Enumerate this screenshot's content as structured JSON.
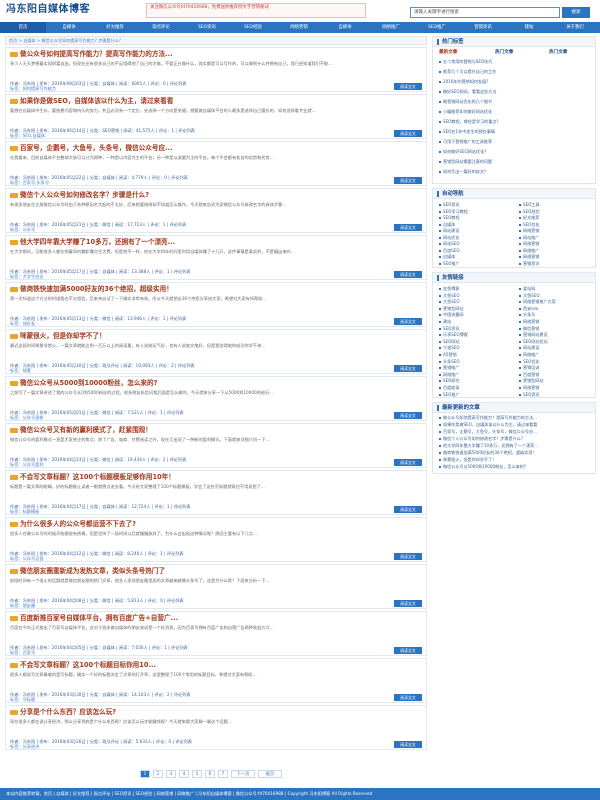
{
  "site": {
    "title": "冯东阳自媒体博客",
    "banner": [
      "关注微信公众号fd70416988，免费送你推荐例文字营销秘诀",
      "",
      ""
    ],
    "search_placeholder": "请输入关键字进行搜索",
    "search_button": "搜索"
  },
  "nav": [
    "首页",
    "自媒体",
    "好文推荐",
    "观点评论",
    "SEO资讯",
    "SEO经验",
    "网络营销",
    "自媒体",
    "网络推广",
    "SEO推广",
    "营销资讯",
    "建站",
    "关于我们"
  ],
  "breadcrumb": "首页 > 自媒体 > 微信公众号如何提高写作能力? 步骤是什么?",
  "articles": [
    {
      "title": "做公众号如何提高写作能力？提高写作能力的方法...",
      "excerpt": "多少人天天梦想着实现财富自由，但现在还有很多自己的不足阻碍他了自己的才能。不管正在做什么，其实都是可以写作的，可以做到什么并拥有自己，我已经知道我们不能…",
      "meta": "作者：冯东阳 | 发布：2016年09月03日 | 分类：自媒体 | 阅读：6005人 | 评论：0 | 评论列表",
      "tags": "标签：如何提高写作能力",
      "more": "阅读全文"
    },
    {
      "title": "如果你是做SEO，自媒体该以什么为主，请过来看看",
      "excerpt": "要想在自媒体中生存，要依靠内容和持久的努力，并且必须有一个定位，先选择一个方向是关键。想要做自媒体平台的人最多是选择自己擅长的，如何选择看专业就…",
      "meta": "作者：冯东阳 | 发布：2016年06月14日 | 分类：SEO营销 | 阅读：41,575人 | 评论：1 | 评论列表",
      "tags": "标签：SEO,自媒体",
      "more": "阅读全文"
    },
    {
      "title": "百家号，企鹅号，大鱼号，头条号，微信公众号应...",
      "excerpt": "在我看来，目前自媒体平台整体大致可以分为两种，一种是以内容为主的平台，另一种是以流量为主的平台。每个平台都有各自的优势和劣势…",
      "meta": "作者：冯东阳 | 发布：2016年05月22日 | 分类：自媒体 | 阅读：4,779人 | 评论：0 | 评论列表",
      "tags": "标签：百家号,头条号",
      "more": "阅读全文"
    },
    {
      "title": "微信个人公众号如何修改名字？步骤是什么?",
      "excerpt": "有很多朋友在注册微信公众号时由于各种原因名字起的不太好，后来想要修改却不知道怎么操作。今天就来告诉大家微信公众号修改名字的具体步骤…",
      "meta": "作者：冯东阳 | 发布：2016年05月21日 | 分类：微信 | 阅读：17,713人 | 评论：1 | 评论列表",
      "tags": "标签：公众号",
      "more": "阅读全文"
    },
    {
      "title": "他大学四年靠大学赚了10多万，还拥有了一个漂亮...",
      "excerpt": "在大学期间，可能很多人都在想着如何兼职赚点生活费，但是他不一样，他在大学四年时间里利用自媒体赚了十几万，这件事情是真实的，不是编出来的…",
      "meta": "作者：冯东阳 | 发布：2016年05月17日 | 分类：自媒体 | 阅读：13,388人 | 评论：1 | 评论列表",
      "tags": "标签：大学生创业",
      "more": "阅读全文"
    },
    {
      "title": "做商铁快速加满5000好友的36个绝招，超级实用！",
      "excerpt": "第一次知道这个方法的时候我也不太相信，后来亲自试了一下确实非常有效，所以今天就把这36个绝招分享给大家，希望对大家有所帮助…",
      "meta": "作者：冯东阳 | 发布：2016年05月13日 | 分类：微信 | 阅读：13,946人 | 评论：1 | 评论列表",
      "tags": "标签：加好友",
      "more": "阅读全文"
    },
    {
      "title": "咪蒙很火，但是你却学不了！",
      "excerpt": "最近这段时间咪蒙非常火，一篇文章就能达到一百万以上的阅读量，有人说她运气好，也有人说她文笔好，但是我觉得她的成功你学不来…",
      "meta": "作者：冯东阳 | 发布：2016年05月10日 | 分类：观点评论 | 阅读：10,093人 | 评论：2 | 评论列表",
      "tags": "标签：咪蒙",
      "more": "阅读全文"
    },
    {
      "title": "微信公众号从5000到10000粉丝，怎么来的?",
      "excerpt": "之前写了一篇文章讲述了我的公众号从0到5000粉丝的过程，很多朋友私信问我后面是怎么做的，今天就来分享一下从5000到10000的经历…",
      "meta": "作者：冯东阳 | 发布：2016年05月01日 | 分类：微信 | 阅读：7,521人 | 评论：1 | 评论列表",
      "tags": "标签：公众号涨粉",
      "more": "阅读全文"
    },
    {
      "title": "微信公众号又有新的赢利模式了，赶紧围观！",
      "excerpt": "微信公众号的盈利模式一直是大家关注的焦点，除了广告、电商、付费阅读之外，现在又出现了一种新的盈利模式，下面就来详细介绍一下…",
      "meta": "作者：冯东阳 | 发布：2016年04月23日 | 分类：微信 | 阅读：19,434人 | 评论：2 | 评论列表",
      "tags": "标签：公众号盈利",
      "more": "阅读全文"
    },
    {
      "title": "不会写文章标题？这100个标题模板足够你用10年！",
      "excerpt": "标题是一篇文章的眼睛，好的标题能让读者一眼就想点进去看。今天给大家整理了100个标题模板，学会了这些写标题就再也不用发愁了…",
      "meta": "作者：冯东阳 | 发布：2016年04月17日 | 分类：自媒体 | 阅读：12,724人 | 评论：1 | 评论列表",
      "tags": "标签：标题模板",
      "more": "阅读全文"
    },
    {
      "title": "为什么很多人的公众号都运营不下去了?",
      "excerpt": "很多人在做公众号的时候开始都很有热情，但是坚持了一段时间以后就慢慢放弃了，为什么会出现这种情况呢？原因主要有以下几点…",
      "meta": "作者：冯东阳 | 发布：2016年04月12日 | 分类：微信 | 阅读：8,240人 | 评论：1 | 评论列表",
      "tags": "标签：公众号运营",
      "more": "阅读全文"
    },
    {
      "title": "微信朋友圈重新成为发热文章，类似头条号热门了",
      "excerpt": "前段时间有一个很火的话题就是微信朋友圈的热门文章，很多人发现朋友圈里面的文章越来越像头条号了，这是为什么呢？下面来分析一下…",
      "meta": "作者：冯东阳 | 发布：2016年04月08日 | 分类：微信 | 阅读：5,813人 | 评论：0 | 评论列表",
      "tags": "标签：朋友圈",
      "more": "阅读全文"
    },
    {
      "title": "百度新推百家号自媒体平台，拥有百度广告+自营广...",
      "excerpt": "百度在今年正式推出了百家号自媒体平台，这对于很多做自媒体的朋友来说是一个好消息，因为百家号拥有百度广告和自营广告两种收益方式…",
      "meta": "作者：冯东阳 | 发布：2016年04月05日 | 分类：自媒体 | 阅读：7,030人 | 评论：1 | 评论列表",
      "tags": "标签：百家号",
      "more": "阅读全文"
    },
    {
      "title": "不会写文章标题？这100个标题目标你用10...",
      "excerpt": "很多人都说写文章最难的是写标题，确实一个好的标题决定了文章的打开率，这里整理了100个常用的标题目标，希望对大家有帮助…",
      "meta": "作者：冯东阳 | 发布：2016年03月30日 | 分类：自媒体 | 阅读：14,103人 | 评论：2 | 评论列表",
      "tags": "标签：写标题",
      "more": "阅读全文"
    },
    {
      "title": "分享是个什么东西？应该怎么玩?",
      "excerpt": "现在很多人都在说分享经济，那么分享到底是个什么东西呢？应该怎么玩才能赚钱呢？今天就来跟大家聊一聊这个话题…",
      "meta": "作者：冯东阳 | 发布：2016年03月26日 | 分类：观点评论 | 阅读：5,633人 | 评论：0 | 评论列表",
      "tags": "标签：分享经济",
      "more": "阅读全文"
    }
  ],
  "sidebar": {
    "hot_tags_title": "热门标签",
    "hot_tabs": [
      "最新文章",
      "热门文章",
      "热门文章"
    ],
    "hot_list": [
      "五个常用的营销与SEO技巧",
      "推荐几个可以提升自己的工作",
      "2016年的营销如何发展?",
      "做好SEO网站，看看这些方法",
      "做营销网站优化的几个细节",
      "小编推荐如何做好网站优化",
      "SEO教程，哪些是学习的重点?",
      "SEO在1年中发生的那些事情",
      "可用于营销推广的工具推荐",
      "如何做好SEO网站优化?",
      "营销型网站需要注意的问题",
      "如何写出一篇好的软文?"
    ],
    "cat_title": "自动导航",
    "cat_tags": [
      "SEO资讯",
      "SEO工具",
      "SEO学习教程",
      "SEO经验",
      "SEO教程",
      "好文推荐",
      "自媒体",
      "SEO优化",
      "网站建设",
      "网络营销",
      "网站优化",
      "网站推广",
      "网站SEO",
      "网络营销",
      "百度SEO",
      "网络推广",
      "自媒体",
      "网络营销",
      "SEO推广",
      "营销资讯"
    ],
    "friend_title": "友情链接",
    "friend_links": [
      "金鱼博客",
      "爱站网",
      "大鱼SEO",
      "大鱼SEO",
      "大鱼SEO",
      "网络营销推广方案",
      "营销型网站",
      "西安seo",
      "中国流量网",
      "头条号",
      "建站",
      "网络营销",
      "SEO资讯",
      "微信营销",
      "乐享SEO博客",
      "营销网站建设",
      "SEO网站",
      "SEO网站优化",
      "宁波SEO",
      "网站建设",
      "A5营销",
      "网络推广",
      "头条SEO",
      "SEO优化",
      "营销推广",
      "营销培训",
      "网络推广",
      "百度营销",
      "SEO研究",
      "营销型网站",
      "百度收录",
      "网络营销",
      "SEO推广",
      "SEO资讯"
    ],
    "latest_title": "最新更新的文章",
    "latest_list": [
      "做公众号如何提高写作能力？提高写作能力的方法...",
      "如果你是做SEO，自媒体该以什么为主，请过来看看",
      "百家号，企鹅号，大鱼号，头条号，微信公众号应...",
      "微信个人公众号如何修改名字？步骤是什么?",
      "他大学四年靠大学赚了10多万，还拥有了一个漂亮...",
      "做商铁快速加满5000好友的36个绝招，超级实用！",
      "咪蒙很火，但是你却学不了！",
      "微信公众号从5000到10000粉丝，怎么来的?"
    ]
  },
  "pager": [
    "1",
    "2",
    "3",
    "4",
    "5",
    "6",
    "7",
    "下一页",
    "尾页"
  ],
  "footer": "本站内容推荐转载，首页 | 自媒体 | 好文推荐 | 观点评论 | SEO资讯 | SEO经验 | 网络营销 | 网络推广 | 冯东阳自媒体博客 | 微信公众号:fd70416988 | Copyright 冯东阳博客 All Rights Reserved"
}
